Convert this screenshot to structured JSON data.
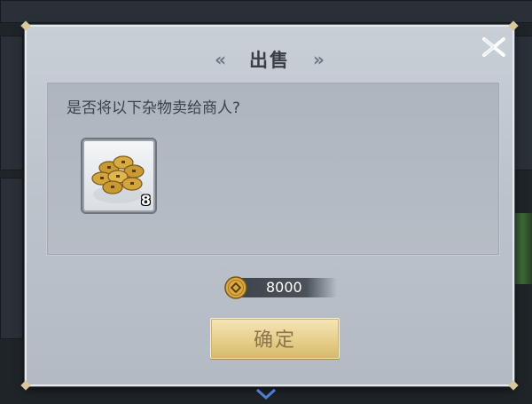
{
  "dialog": {
    "title": "出售",
    "prev_icon": "double-chevron-left-icon",
    "next_icon": "double-chevron-right-icon",
    "close_icon": "close-icon",
    "prompt": "是否将以下杂物卖给商人?",
    "item": {
      "icon": "copper-coins-icon",
      "count": "8"
    },
    "price": {
      "icon": "copper-coin-icon",
      "value": "8000"
    },
    "confirm_label": "确定"
  },
  "colors": {
    "panel": "#bcc3cb",
    "button_gold": "#e7cf8b",
    "button_text": "#8a7450"
  }
}
